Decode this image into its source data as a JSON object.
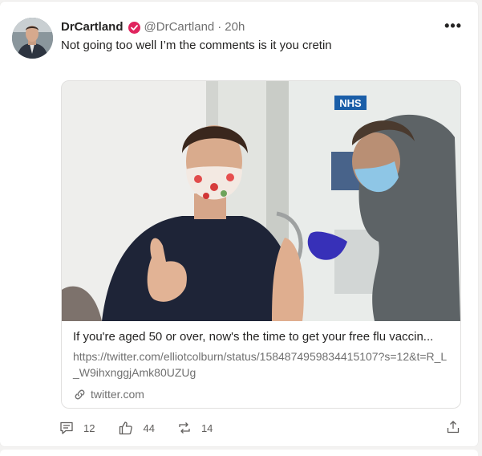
{
  "post": {
    "author_name": "DrCartland",
    "author_handle": "@DrCartland",
    "separator": "·",
    "time": "20h",
    "text": "Not going too well I’m the comments is it you cretin",
    "more_label": "•••"
  },
  "embed": {
    "title": "If you're aged 50 or over, now's the time to get your free flu vaccin...",
    "url": "https://twitter.com/elliotcolburn/status/1584874959834415107?s=12&t=R_L_W9ihxnggjAmk80UZUg",
    "domain": "twitter.com",
    "image_sign_text": "NHS"
  },
  "actions": {
    "comments": "12",
    "likes": "44",
    "retweets": "14"
  },
  "colors": {
    "verified": "#e0245e",
    "text": "#252423",
    "muted": "#707070",
    "border": "#e1e0df"
  },
  "icons": {
    "verified": "verified-badge-icon",
    "more": "more-options-icon",
    "link": "link-icon",
    "comment": "comment-icon",
    "like": "thumbs-up-icon",
    "retweet": "retweet-icon",
    "share": "share-icon"
  }
}
